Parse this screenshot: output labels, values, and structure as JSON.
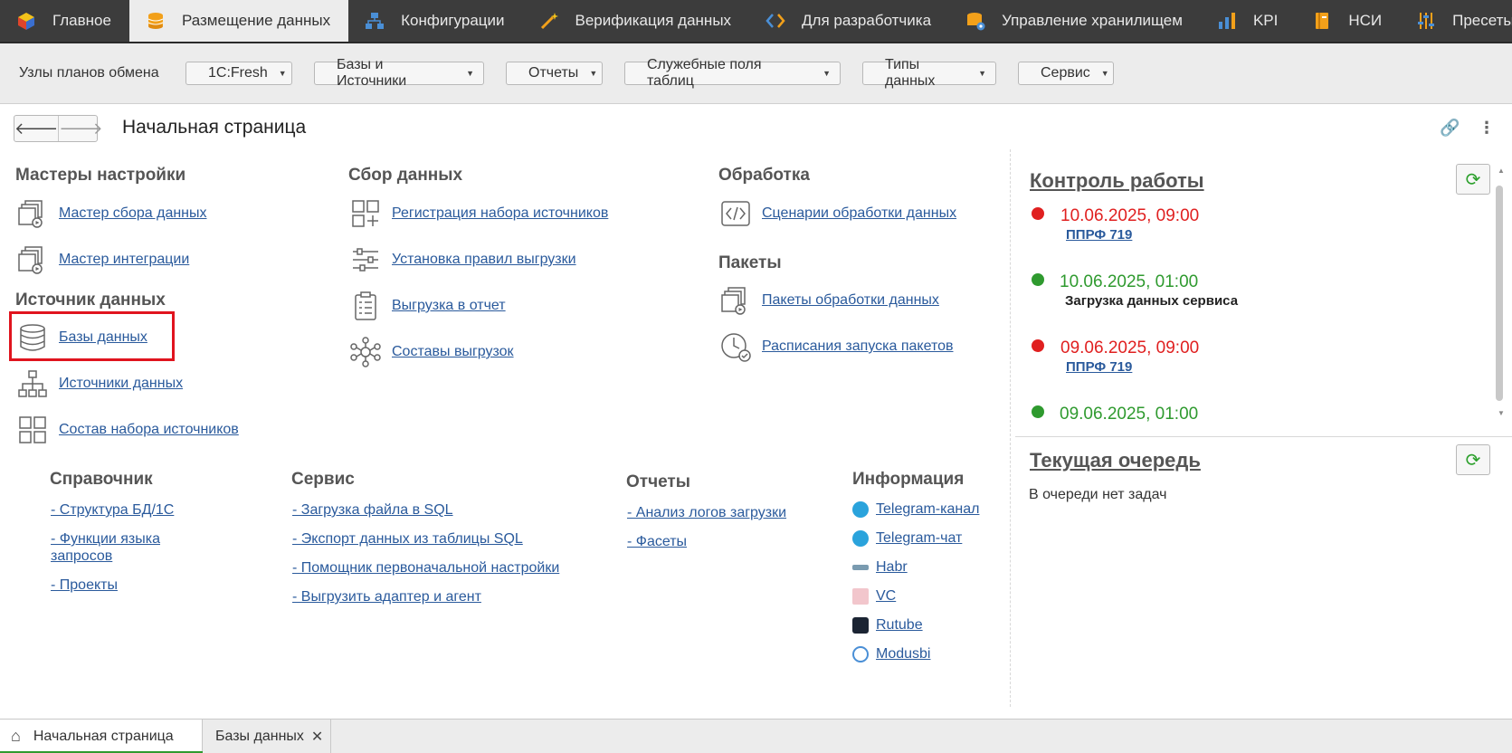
{
  "nav": {
    "tabs": [
      {
        "label": "Главное",
        "icon": "cube-icon"
      },
      {
        "label": "Размещение данных",
        "icon": "database-icon"
      },
      {
        "label": "Конфигурации",
        "icon": "hierarchy-icon"
      },
      {
        "label": "Верификация данных",
        "icon": "magic-wand-icon"
      },
      {
        "label": "Для разработчика",
        "icon": "code-icon"
      },
      {
        "label": "Управление хранилищем",
        "icon": "storage-gear-icon"
      },
      {
        "label": "KPI",
        "icon": "bar-chart-icon"
      },
      {
        "label": "НСИ",
        "icon": "book-icon"
      },
      {
        "label": "Пресеты",
        "icon": "sliders-icon"
      }
    ]
  },
  "subbar": {
    "label": "Узлы планов обмена",
    "dropdowns": [
      "1C:Fresh",
      "Базы и Источники",
      "Отчеты",
      "Служебные поля таблиц",
      "Типы данных",
      "Сервис"
    ]
  },
  "page": {
    "title": "Начальная страница"
  },
  "sections": {
    "masters": {
      "title": "Мастеры настройки",
      "items": [
        "Мастер сбора данных",
        "Мастер интеграции"
      ]
    },
    "source": {
      "title": "Источник данных",
      "items": [
        "Базы данных",
        "Источники данных",
        "Состав набора источников"
      ]
    },
    "collect": {
      "title": "Сбор данных",
      "items": [
        "Регистрация набора источников",
        "Установка правил выгрузки",
        "Выгрузка в отчет",
        "Составы выгрузок"
      ]
    },
    "processing": {
      "title": "Обработка",
      "items": [
        "Сценарии обработки данных"
      ]
    },
    "packets": {
      "title": "Пакеты",
      "items": [
        "Пакеты обработки данных",
        "Расписания запуска пакетов"
      ]
    }
  },
  "lower": {
    "reference": {
      "title": "Справочник",
      "items": [
        "- Структура БД/1С",
        "- Функции языка запросов",
        "- Проекты"
      ]
    },
    "service": {
      "title": "Сервис",
      "items": [
        "- Загрузка файла в SQL",
        "- Экспорт данных из таблицы SQL",
        "- Помощник первоначальной настройки",
        "- Выгрузить адаптер и агент"
      ]
    },
    "reports": {
      "title": "Отчеты",
      "items": [
        "- Анализ логов загрузки",
        "- Фасеты"
      ]
    },
    "info": {
      "title": "Информация",
      "items": [
        {
          "label": "Telegram-канал",
          "color": "#2aa3dc"
        },
        {
          "label": "Telegram-чат",
          "color": "#2aa3dc"
        },
        {
          "label": "Habr",
          "color": "#7a9bb0"
        },
        {
          "label": "VC",
          "color": "#f2c6cc"
        },
        {
          "label": "Rutube",
          "color": "#1b2433"
        },
        {
          "label": "Modusbi",
          "color": "#4a8fd6"
        }
      ]
    }
  },
  "control": {
    "title": "Контроль работы",
    "events": [
      {
        "time": "10.06.2025, 09:00",
        "sub": "ППРФ 719",
        "status": "red"
      },
      {
        "time": "10.06.2025, 01:00",
        "sub": "Загрузка данных сервиса",
        "status": "green"
      },
      {
        "time": "09.06.2025, 09:00",
        "sub": "ППРФ 719",
        "status": "red"
      },
      {
        "time": "09.06.2025, 01:00",
        "sub": "",
        "status": "green"
      }
    ]
  },
  "queue": {
    "title": "Текущая очередь",
    "empty": "В очереди нет задач"
  },
  "bottom": {
    "tabs": [
      "Начальная страница",
      "Базы данных"
    ]
  },
  "colors": {
    "red": "#e02020",
    "green": "#2f9a2f",
    "link": "#2a5a9c",
    "accent_orange": "#f2a01a"
  }
}
